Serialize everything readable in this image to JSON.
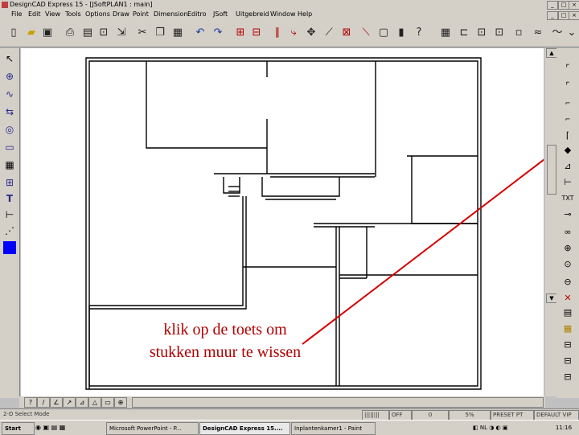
{
  "app": {
    "title": "DesignCAD Express 15 - [JSoftPLAN1 : main]"
  },
  "window_buttons": [
    "_",
    "□",
    "×"
  ],
  "menu": [
    "File",
    "Edit",
    "View",
    "Tools",
    "Options",
    "Draw",
    "Point",
    "Dimension",
    "Editro",
    "JSoft",
    "Uitgebreid",
    "Window",
    "Help"
  ],
  "toolbar_icons": [
    "new-icon",
    "open-icon",
    "save-icon",
    "print-icon",
    "preview-icon",
    "cut-icon",
    "copy-icon",
    "paste-icon",
    "undo-icon",
    "redo-icon",
    "layer-icon",
    "help-icon"
  ],
  "left_tools": [
    "pointer-icon",
    "select-icon",
    "curve-icon",
    "shape-icon",
    "circle-icon",
    "rectangle-icon",
    "grid-icon",
    "text-icon",
    "dimension-icon",
    "dotted-line-icon",
    "color-swatch-icon"
  ],
  "right_tools": [
    "wall-icon",
    "door-icon",
    "eraser-icon",
    "measure-icon",
    "text-tool-icon",
    "zoom-icon",
    "delete-icon"
  ],
  "annotation": {
    "line1": "klik op de toets om",
    "line2": "stukken muur te wissen",
    "color": "#b00000"
  },
  "status": {
    "left": "2-D Select Mode",
    "mode": "OFF",
    "value": "0",
    "zoom": "5%",
    "preset": "PRESET PT",
    "default": "DEFAULT VIP"
  },
  "taskbar": {
    "start": "Start",
    "tasks": [
      "Microsoft PowerPoint - P...",
      "DesignCAD Express 15....",
      "Inplantenkamer1 - Paint"
    ],
    "clock": "11:16"
  },
  "accent": "#0000ff"
}
